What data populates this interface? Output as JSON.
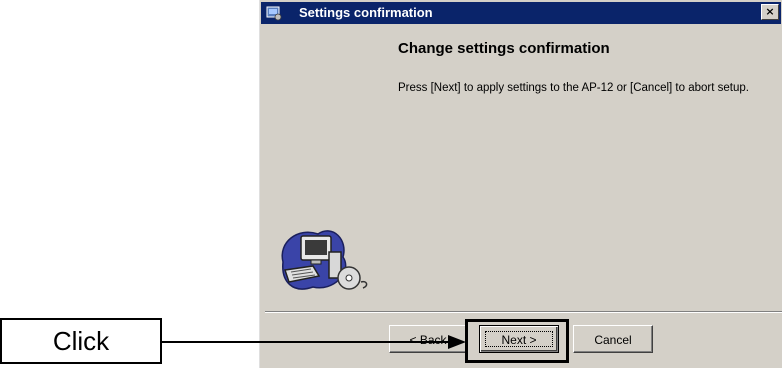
{
  "dialog": {
    "title": "Settings confirmation",
    "close_label": "×",
    "heading": "Change settings confirmation",
    "message": "Press [Next] to apply settings to the AP-12 or [Cancel] to abort setup.",
    "icons": {
      "title": "setup-app-icon",
      "illustration": "computer-with-cd-icon"
    }
  },
  "buttons": {
    "back_label": "< Back",
    "next_label": "Next >",
    "cancel_label": "Cancel"
  },
  "callout": {
    "label": "Click"
  }
}
